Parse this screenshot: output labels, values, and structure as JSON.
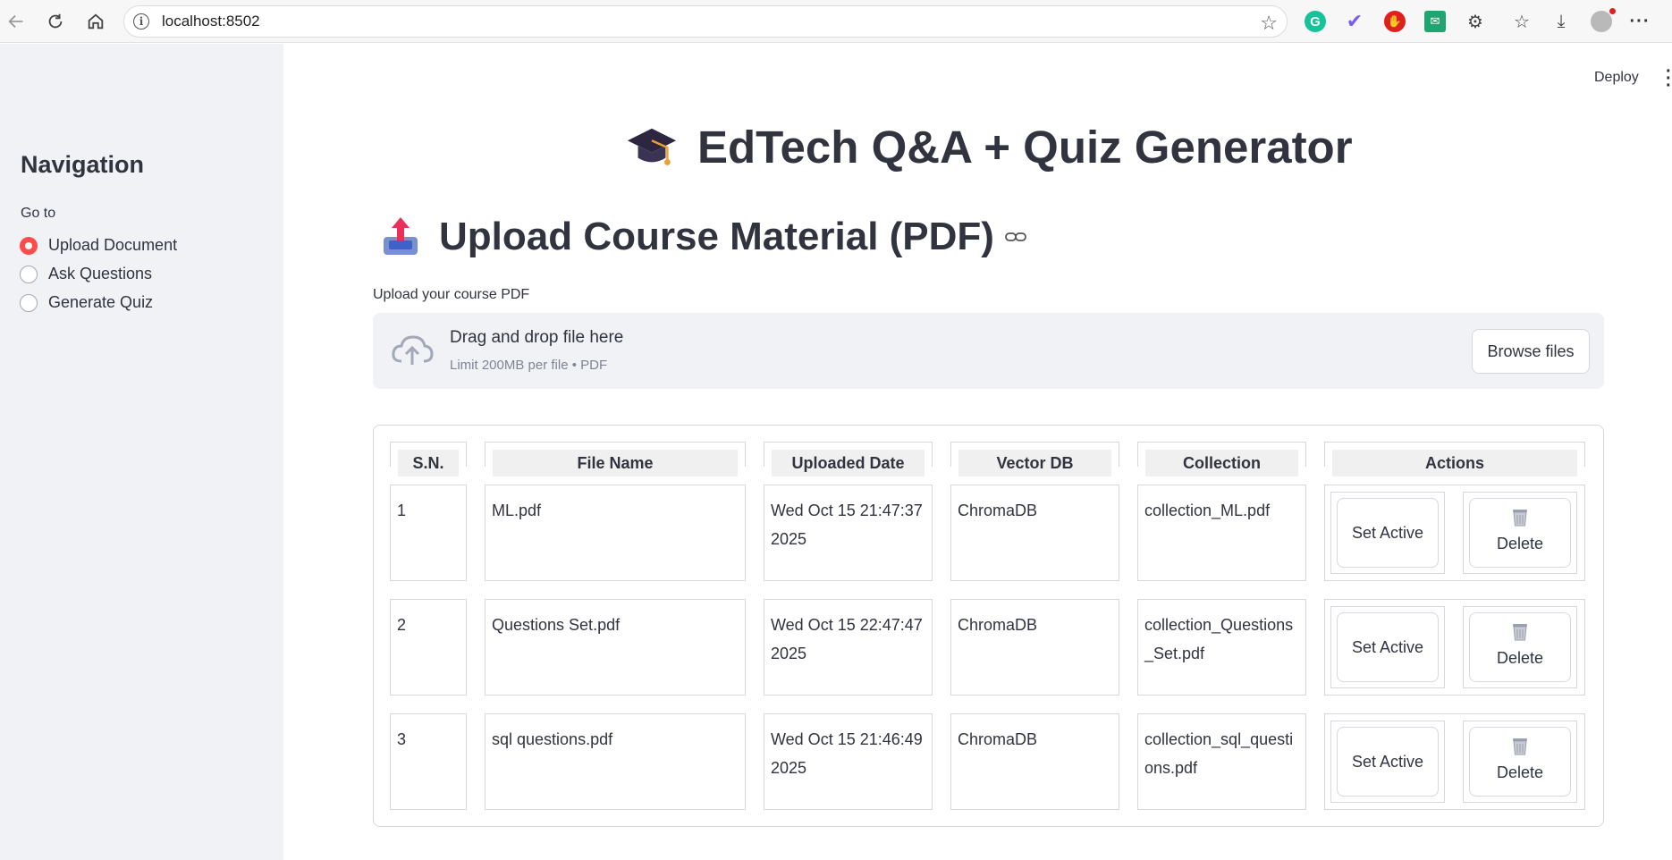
{
  "browser": {
    "url": "localhost:8502"
  },
  "header": {
    "deploy_label": "Deploy"
  },
  "sidebar": {
    "title": "Navigation",
    "radio_label": "Go to",
    "options": [
      {
        "label": "Upload Document",
        "selected": true
      },
      {
        "label": "Ask Questions",
        "selected": false
      },
      {
        "label": "Generate Quiz",
        "selected": false
      }
    ]
  },
  "main": {
    "title": "EdTech Q&A + Quiz Generator",
    "section_title": "Upload Course Material (PDF)",
    "uploader": {
      "label": "Upload your course PDF",
      "drop_text": "Drag and drop file here",
      "limit_text": "Limit 200MB per file • PDF",
      "browse_label": "Browse files"
    },
    "table": {
      "headers": [
        "S.N.",
        "File Name",
        "Uploaded Date",
        "Vector DB",
        "Collection",
        "Actions"
      ],
      "rows": [
        {
          "sn": "1",
          "file": "ML.pdf",
          "date": "Wed Oct 15 21:47:37 2025",
          "db": "ChromaDB",
          "collection": "collection_ML.pdf"
        },
        {
          "sn": "2",
          "file": "Questions Set.pdf",
          "date": "Wed Oct 15 22:47:47 2025",
          "db": "ChromaDB",
          "collection": "collection_Questions_Set.pdf"
        },
        {
          "sn": "3",
          "file": "sql questions.pdf",
          "date": "Wed Oct 15 21:46:49 2025",
          "db": "ChromaDB",
          "collection": "collection_sql_questions.pdf"
        }
      ],
      "set_active_label": "Set Active",
      "delete_label": "Delete"
    }
  },
  "colors": {
    "accent": "#ff4b4b",
    "sidebar_bg": "#f0f2f6",
    "text": "#31333f"
  }
}
